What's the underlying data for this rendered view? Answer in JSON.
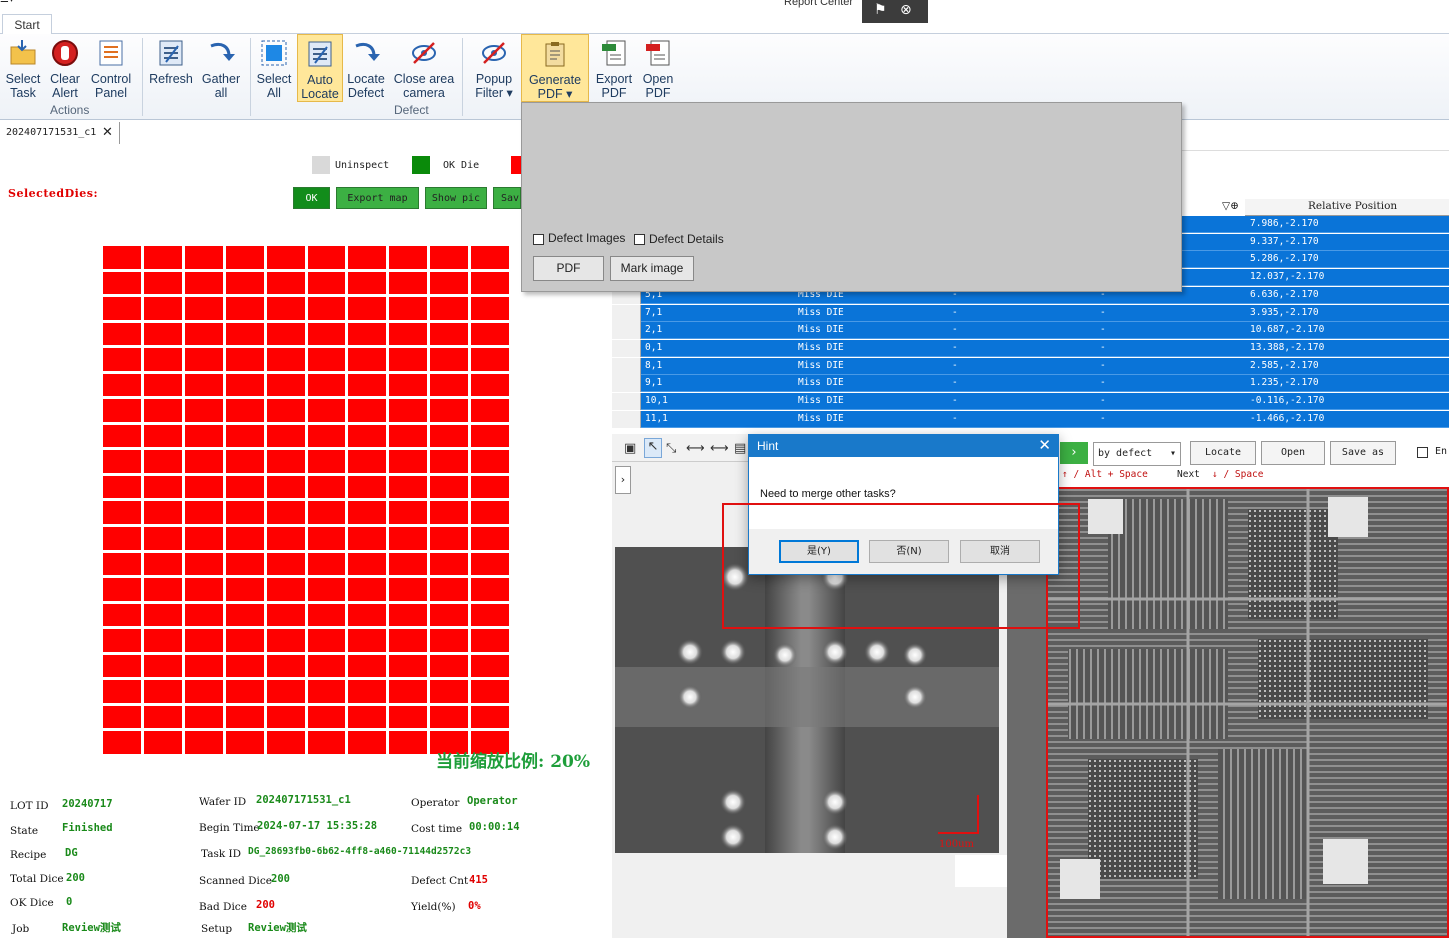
{
  "window": {
    "title": "Report Center"
  },
  "ribbon": {
    "tab": "Start",
    "buttons": [
      {
        "id": "select-task",
        "l1": "Select",
        "l2": "Task"
      },
      {
        "id": "clear-alert",
        "l1": "Clear",
        "l2": "Alert"
      },
      {
        "id": "control-panel",
        "l1": "Control",
        "l2": "Panel"
      },
      {
        "id": "refresh",
        "l1": "Refresh",
        "l2": ""
      },
      {
        "id": "gather-all",
        "l1": "Gather",
        "l2": "all"
      },
      {
        "id": "select-all",
        "l1": "Select",
        "l2": "All"
      },
      {
        "id": "auto-locate",
        "l1": "Auto",
        "l2": "Locate"
      },
      {
        "id": "locate-defect",
        "l1": "Locate",
        "l2": "Defect"
      },
      {
        "id": "close-area-camera",
        "l1": "Close area",
        "l2": "camera"
      },
      {
        "id": "popup-filter",
        "l1": "Popup",
        "l2": "Filter ▾"
      },
      {
        "id": "generate-pdf",
        "l1": "Generate",
        "l2": "PDF ▾"
      },
      {
        "id": "export-pdf",
        "l1": "Export",
        "l2": "PDF"
      },
      {
        "id": "open-pdf",
        "l1": "Open",
        "l2": "PDF"
      }
    ],
    "groups": {
      "actions": "Actions",
      "defect": "Defect"
    }
  },
  "doc_tab": {
    "label": "202407171531_c1"
  },
  "legend": [
    {
      "label": "Uninspect",
      "color": "#d9d9d9"
    },
    {
      "label": "OK Die",
      "color": "#0a8a0a"
    },
    {
      "label": "",
      "color": "#ff0000"
    }
  ],
  "left_panel": {
    "selected_dies_label": "SelectedDies:",
    "buttons": [
      "OK",
      "Export map",
      "Show pic",
      "Sav"
    ],
    "zoom_text": "当前缩放比例: 20%"
  },
  "info": {
    "lot_id": {
      "label": "LOT ID",
      "value": "20240717"
    },
    "state": {
      "label": "State",
      "value": "Finished"
    },
    "recipe": {
      "label": "Recipe",
      "value": "DG"
    },
    "total_dice": {
      "label": "Total Dice",
      "value": "200"
    },
    "ok_dice": {
      "label": "OK Dice",
      "value": "0"
    },
    "job": {
      "label": "Job",
      "value": "Review测试"
    },
    "wafer_id": {
      "label": "Wafer ID",
      "value": "202407171531_c1"
    },
    "begin_time": {
      "label": "Begin Time",
      "value": "2024-07-17 15:35:28"
    },
    "task_id": {
      "label": "Task ID",
      "value": "DG_28693fb0-6b62-4ff8-a460-71144d2572c3"
    },
    "scanned_dice": {
      "label": "Scanned Dice",
      "value": "200"
    },
    "bad_dice": {
      "label": "Bad Dice",
      "value": "200"
    },
    "setup": {
      "label": "Setup",
      "value": "Review测试"
    },
    "operator": {
      "label": "Operator",
      "value": "Operator"
    },
    "cost_time": {
      "label": "Cost time",
      "value": "00:00:14"
    },
    "defect_cnt": {
      "label": "Defect Cnt",
      "value": "415"
    },
    "yield": {
      "label": "Yield(%)",
      "value": "0%"
    }
  },
  "grid": {
    "header_filter": "▽⊕",
    "header_relpos": "Relative Position",
    "rows": [
      {
        "coord": "",
        "type": "",
        "a": "",
        "b": "",
        "pos": "7.986,-2.170"
      },
      {
        "coord": "",
        "type": "",
        "a": "",
        "b": "",
        "pos": "9.337,-2.170"
      },
      {
        "coord": "",
        "type": "",
        "a": "",
        "b": "",
        "pos": "5.286,-2.170"
      },
      {
        "coord": "",
        "type": "",
        "a": "",
        "b": "",
        "pos": "12.037,-2.170"
      },
      {
        "coord": "5,1",
        "type": "Miss DIE",
        "a": "-",
        "b": "-",
        "pos": "6.636,-2.170"
      },
      {
        "coord": "7,1",
        "type": "Miss DIE",
        "a": "-",
        "b": "-",
        "pos": "3.935,-2.170"
      },
      {
        "coord": "2,1",
        "type": "Miss DIE",
        "a": "-",
        "b": "-",
        "pos": "10.687,-2.170"
      },
      {
        "coord": "0,1",
        "type": "Miss DIE",
        "a": "-",
        "b": "-",
        "pos": "13.388,-2.170"
      },
      {
        "coord": "8,1",
        "type": "Miss DIE",
        "a": "-",
        "b": "-",
        "pos": "2.585,-2.170"
      },
      {
        "coord": "9,1",
        "type": "Miss DIE",
        "a": "-",
        "b": "-",
        "pos": "1.235,-2.170"
      },
      {
        "coord": "10,1",
        "type": "Miss DIE",
        "a": "-",
        "b": "-",
        "pos": "-0.116,-2.170"
      },
      {
        "coord": "11,1",
        "type": "Miss DIE",
        "a": "-",
        "b": "-",
        "pos": "-1.466,-2.170"
      }
    ]
  },
  "generate_popup": {
    "defect_images": "Defect Images",
    "defect_details": "Defect Details",
    "pdf": "PDF",
    "mark_image": "Mark image"
  },
  "viewer": {
    "scale_label": "100um",
    "sort_mode": "by defect",
    "locate": "Locate",
    "open": "Open",
    "save_as": "Save as",
    "en": "En",
    "prev_hint": "↑ / Alt + Space",
    "next_label": "Next",
    "next_hint": "↓ / Space"
  },
  "hint_dialog": {
    "title": "Hint",
    "message": "Need to merge other tasks?",
    "yes": "是(Y)",
    "no": "否(N)",
    "cancel": "取消"
  }
}
